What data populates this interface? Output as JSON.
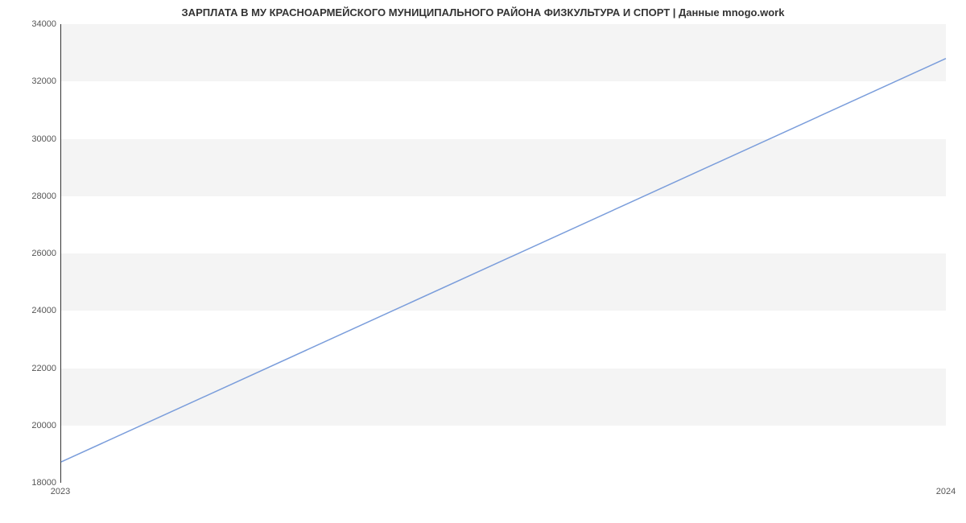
{
  "chart_data": {
    "type": "line",
    "title": "ЗАРПЛАТА В МУ КРАСНОАРМЕЙСКОГО МУНИЦИПАЛЬНОГО РАЙОНА ФИЗКУЛЬТУРА И СПОРТ | Данные mnogo.work",
    "xlabel": "",
    "ylabel": "",
    "x": [
      2023,
      2024
    ],
    "values": [
      18700,
      32800
    ],
    "x_ticks": [
      "2023",
      "2024"
    ],
    "y_ticks": [
      18000,
      20000,
      22000,
      24000,
      26000,
      28000,
      30000,
      32000,
      34000
    ],
    "ylim": [
      18000,
      34000
    ],
    "xlim": [
      2023,
      2024
    ]
  },
  "colors": {
    "line": "#7a9ddb",
    "band": "#f4f4f4"
  }
}
